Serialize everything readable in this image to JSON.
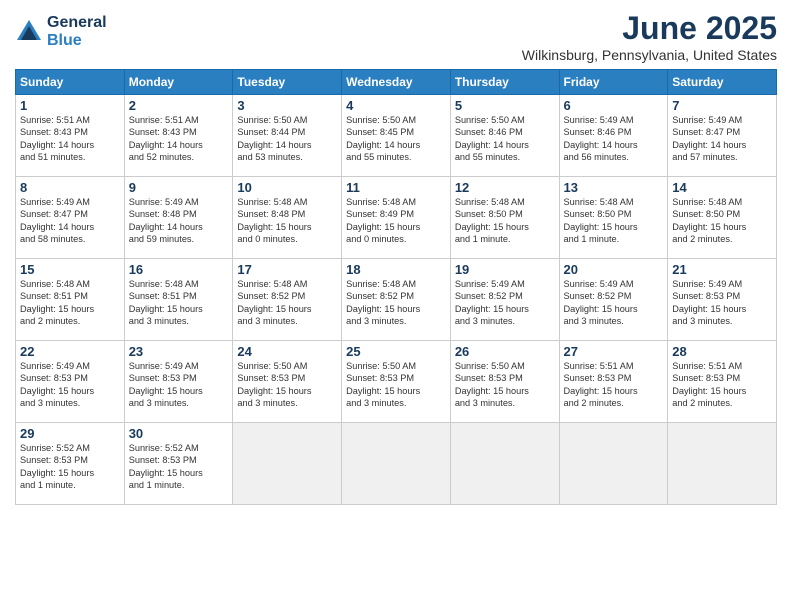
{
  "logo": {
    "general": "General",
    "blue": "Blue"
  },
  "title": "June 2025",
  "location": "Wilkinsburg, Pennsylvania, United States",
  "days_header": [
    "Sunday",
    "Monday",
    "Tuesday",
    "Wednesday",
    "Thursday",
    "Friday",
    "Saturday"
  ],
  "weeks": [
    [
      {
        "day": "1",
        "text": "Sunrise: 5:51 AM\nSunset: 8:43 PM\nDaylight: 14 hours\nand 51 minutes."
      },
      {
        "day": "2",
        "text": "Sunrise: 5:51 AM\nSunset: 8:43 PM\nDaylight: 14 hours\nand 52 minutes."
      },
      {
        "day": "3",
        "text": "Sunrise: 5:50 AM\nSunset: 8:44 PM\nDaylight: 14 hours\nand 53 minutes."
      },
      {
        "day": "4",
        "text": "Sunrise: 5:50 AM\nSunset: 8:45 PM\nDaylight: 14 hours\nand 55 minutes."
      },
      {
        "day": "5",
        "text": "Sunrise: 5:50 AM\nSunset: 8:46 PM\nDaylight: 14 hours\nand 55 minutes."
      },
      {
        "day": "6",
        "text": "Sunrise: 5:49 AM\nSunset: 8:46 PM\nDaylight: 14 hours\nand 56 minutes."
      },
      {
        "day": "7",
        "text": "Sunrise: 5:49 AM\nSunset: 8:47 PM\nDaylight: 14 hours\nand 57 minutes."
      }
    ],
    [
      {
        "day": "8",
        "text": "Sunrise: 5:49 AM\nSunset: 8:47 PM\nDaylight: 14 hours\nand 58 minutes."
      },
      {
        "day": "9",
        "text": "Sunrise: 5:49 AM\nSunset: 8:48 PM\nDaylight: 14 hours\nand 59 minutes."
      },
      {
        "day": "10",
        "text": "Sunrise: 5:48 AM\nSunset: 8:48 PM\nDaylight: 15 hours\nand 0 minutes."
      },
      {
        "day": "11",
        "text": "Sunrise: 5:48 AM\nSunset: 8:49 PM\nDaylight: 15 hours\nand 0 minutes."
      },
      {
        "day": "12",
        "text": "Sunrise: 5:48 AM\nSunset: 8:50 PM\nDaylight: 15 hours\nand 1 minute."
      },
      {
        "day": "13",
        "text": "Sunrise: 5:48 AM\nSunset: 8:50 PM\nDaylight: 15 hours\nand 1 minute."
      },
      {
        "day": "14",
        "text": "Sunrise: 5:48 AM\nSunset: 8:50 PM\nDaylight: 15 hours\nand 2 minutes."
      }
    ],
    [
      {
        "day": "15",
        "text": "Sunrise: 5:48 AM\nSunset: 8:51 PM\nDaylight: 15 hours\nand 2 minutes."
      },
      {
        "day": "16",
        "text": "Sunrise: 5:48 AM\nSunset: 8:51 PM\nDaylight: 15 hours\nand 3 minutes."
      },
      {
        "day": "17",
        "text": "Sunrise: 5:48 AM\nSunset: 8:52 PM\nDaylight: 15 hours\nand 3 minutes."
      },
      {
        "day": "18",
        "text": "Sunrise: 5:48 AM\nSunset: 8:52 PM\nDaylight: 15 hours\nand 3 minutes."
      },
      {
        "day": "19",
        "text": "Sunrise: 5:49 AM\nSunset: 8:52 PM\nDaylight: 15 hours\nand 3 minutes."
      },
      {
        "day": "20",
        "text": "Sunrise: 5:49 AM\nSunset: 8:52 PM\nDaylight: 15 hours\nand 3 minutes."
      },
      {
        "day": "21",
        "text": "Sunrise: 5:49 AM\nSunset: 8:53 PM\nDaylight: 15 hours\nand 3 minutes."
      }
    ],
    [
      {
        "day": "22",
        "text": "Sunrise: 5:49 AM\nSunset: 8:53 PM\nDaylight: 15 hours\nand 3 minutes."
      },
      {
        "day": "23",
        "text": "Sunrise: 5:49 AM\nSunset: 8:53 PM\nDaylight: 15 hours\nand 3 minutes."
      },
      {
        "day": "24",
        "text": "Sunrise: 5:50 AM\nSunset: 8:53 PM\nDaylight: 15 hours\nand 3 minutes."
      },
      {
        "day": "25",
        "text": "Sunrise: 5:50 AM\nSunset: 8:53 PM\nDaylight: 15 hours\nand 3 minutes."
      },
      {
        "day": "26",
        "text": "Sunrise: 5:50 AM\nSunset: 8:53 PM\nDaylight: 15 hours\nand 3 minutes."
      },
      {
        "day": "27",
        "text": "Sunrise: 5:51 AM\nSunset: 8:53 PM\nDaylight: 15 hours\nand 2 minutes."
      },
      {
        "day": "28",
        "text": "Sunrise: 5:51 AM\nSunset: 8:53 PM\nDaylight: 15 hours\nand 2 minutes."
      }
    ],
    [
      {
        "day": "29",
        "text": "Sunrise: 5:52 AM\nSunset: 8:53 PM\nDaylight: 15 hours\nand 1 minute."
      },
      {
        "day": "30",
        "text": "Sunrise: 5:52 AM\nSunset: 8:53 PM\nDaylight: 15 hours\nand 1 minute."
      },
      {
        "day": "",
        "text": ""
      },
      {
        "day": "",
        "text": ""
      },
      {
        "day": "",
        "text": ""
      },
      {
        "day": "",
        "text": ""
      },
      {
        "day": "",
        "text": ""
      }
    ]
  ]
}
